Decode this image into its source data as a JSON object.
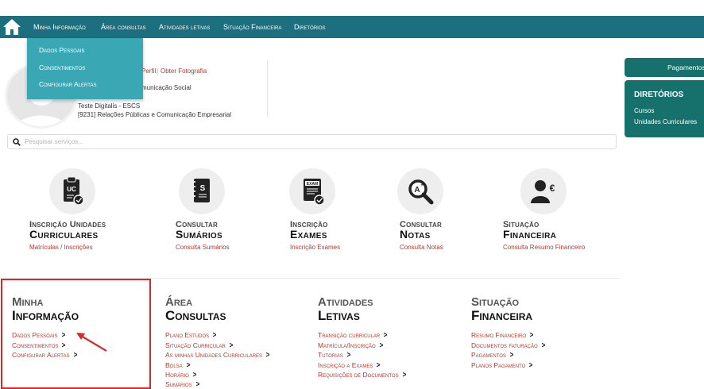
{
  "nav": {
    "items": [
      {
        "label": "Minha Informação"
      },
      {
        "label": "Área consultas"
      },
      {
        "label": "Atividades letivas"
      },
      {
        "label": "Situação Financeira"
      },
      {
        "label": "Diretórios"
      }
    ],
    "dropdown": [
      {
        "label": "Dados Pessoais"
      },
      {
        "label": "Consentimentos"
      },
      {
        "label": "Configurar Alertas"
      }
    ]
  },
  "profile": {
    "links": {
      "perfil": "Perfil",
      "separator": "|",
      "foto": "Obter Fotografia"
    },
    "line1": "municação Social",
    "line2": "Teste Digitalis - ESCS",
    "line3": "[9231] Relações Públicas e Comunicação Empresarial"
  },
  "right": {
    "payments": "Pagamentos",
    "directories_title": "DIRETÓRIOS",
    "directories": [
      "Cursos",
      "Unidades Curriculares"
    ]
  },
  "search": {
    "placeholder": "Pesquisar serviços..."
  },
  "tiles": [
    {
      "t1": "Inscrição Unidades",
      "t2": "Curriculares",
      "link": "Matrículas / Inscrições",
      "icon": "uc-clipboard-icon"
    },
    {
      "t1": "Consultar",
      "t2": "Sumários",
      "link": "Consulta Sumários",
      "icon": "notebook-icon"
    },
    {
      "t1": "Inscrição",
      "t2": "Exames",
      "link": "Inscrição Exames",
      "icon": "exam-icon"
    },
    {
      "t1": "Consultar",
      "t2": "Notas",
      "link": "Consulta Notas",
      "icon": "magnifier-grade-icon"
    },
    {
      "t1": "Situação",
      "t2": "Financeira",
      "link": "Consulta Resumo Financeiro",
      "icon": "user-euro-icon"
    }
  ],
  "sections": [
    {
      "t1": "Minha",
      "t2": "Informação",
      "links": [
        "Dados Pessoais",
        "Consentimentos",
        "Configurar Alertas"
      ]
    },
    {
      "t1": "Área",
      "t2": "Consultas",
      "links": [
        "Plano Estudos",
        "Situação Curricular",
        "As minhas Unidades Curriculares",
        "Bolsa",
        "Horário",
        "Sumários"
      ]
    },
    {
      "t1": "Atividades",
      "t2": "Letivas",
      "links": [
        "Transição curricular",
        "Matrícula/Inscrição",
        "Tutorias",
        "Inscrição a Exames",
        "Requisições de Documentos"
      ]
    },
    {
      "t1": "Situação",
      "t2": "Financeira",
      "links": [
        "Resumo Financeiro",
        "Documentos faturação",
        "Pagamentos",
        "Planos Pagamento"
      ]
    }
  ],
  "colors": {
    "nav": "#1b6f7e",
    "dropdown": "#3aa8b4",
    "link": "#b23a2e",
    "panel": "#16706b",
    "highlight": "#d42a2a"
  }
}
